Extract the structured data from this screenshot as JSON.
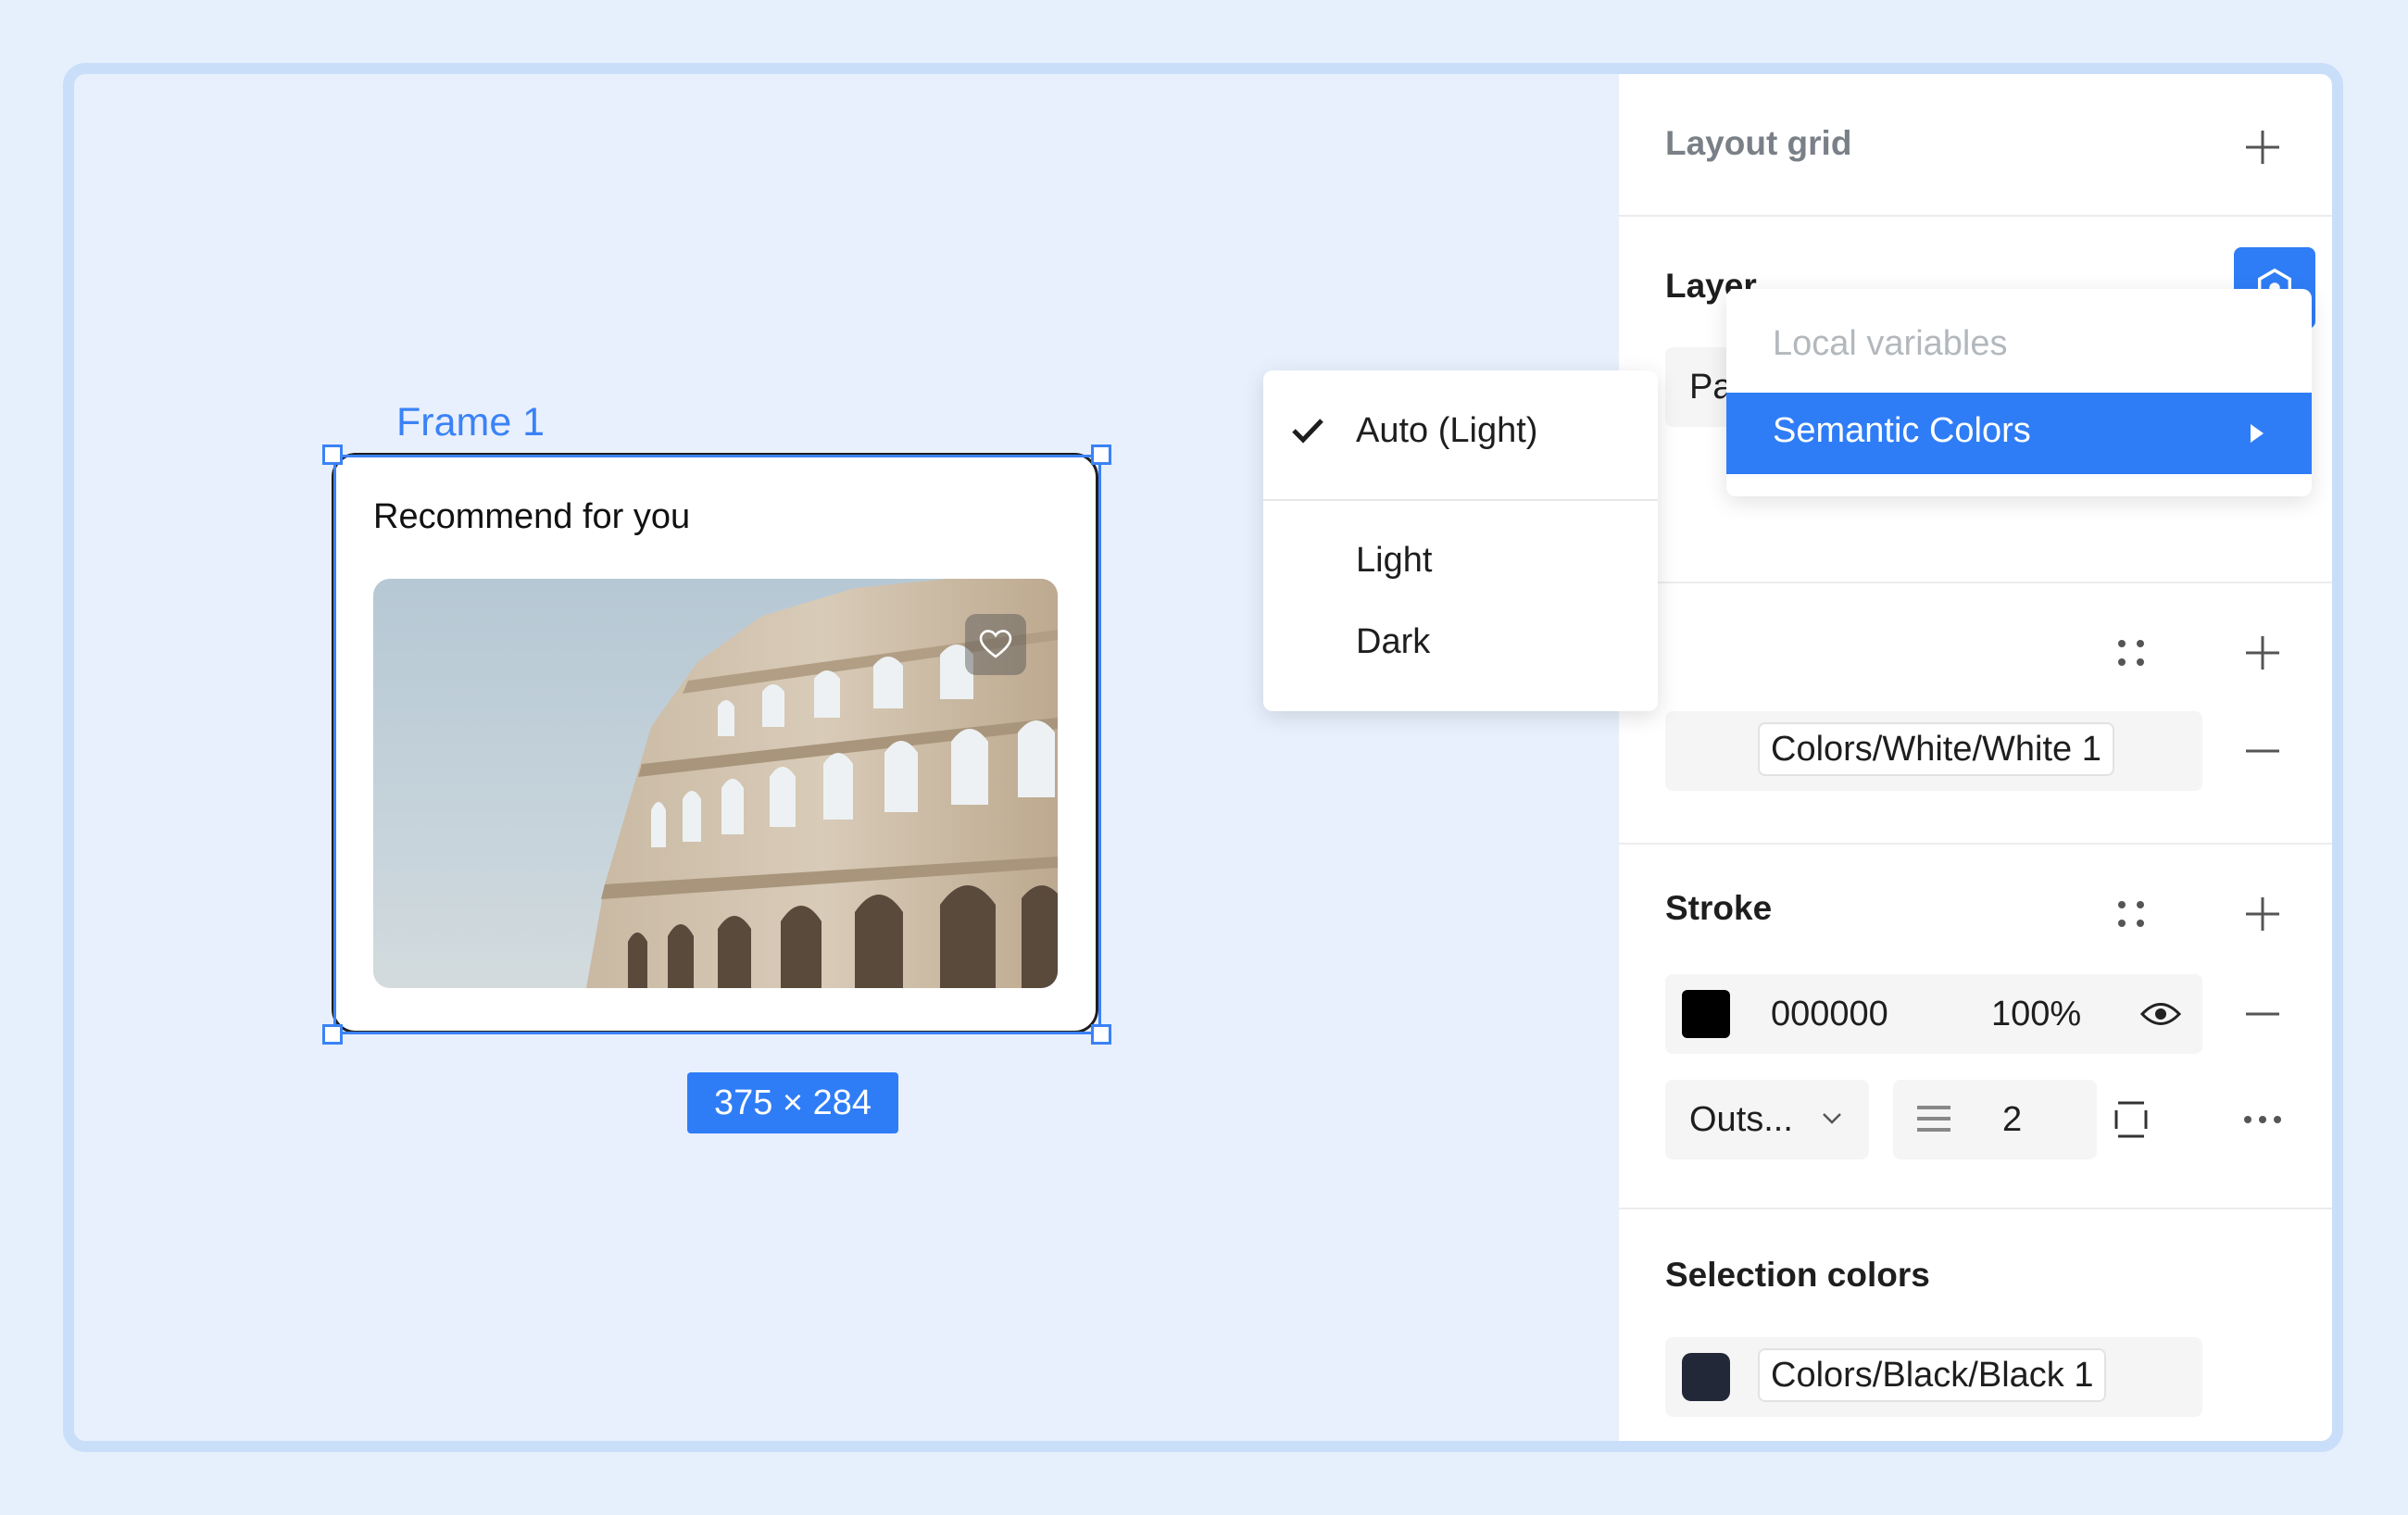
{
  "canvas": {
    "frame_label": "Frame 1",
    "card_title": "Recommend for you",
    "size_label": "375 × 284"
  },
  "dropdown": {
    "items": [
      {
        "label": "Auto (Light)",
        "checked": true
      },
      {
        "label": "Light",
        "checked": false
      },
      {
        "label": "Dark",
        "checked": false
      }
    ]
  },
  "panel": {
    "layout_grid": {
      "title": "Layout grid"
    },
    "layer": {
      "title": "Layer",
      "mode_partial": "Pa:"
    },
    "variables_menu": {
      "header": "Local variables",
      "active_item": "Semantic Colors"
    },
    "fill": {
      "variable": "Colors/White/White 1"
    },
    "stroke": {
      "title": "Stroke",
      "hex": "000000",
      "opacity": "100%",
      "position": "Outs...",
      "weight": "2",
      "color": "#000000"
    },
    "selection_colors": {
      "title": "Selection colors",
      "variable": "Colors/Black/Black 1",
      "color": "#222838"
    }
  },
  "colors": {
    "accent": "#2f7df6",
    "selection": "#3b82f6"
  }
}
